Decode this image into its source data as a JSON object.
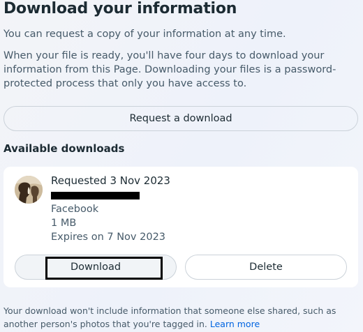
{
  "header": {
    "title": "Download your information"
  },
  "intro": {
    "paragraph1": "You can request a copy of your information at any time.",
    "paragraph2": "When your file is ready, you'll have four days to download your information from this Page. Downloading your files is a password-protected process that only you have access to."
  },
  "request_button_label": "Request a download",
  "downloads": {
    "section_title": "Available downloads",
    "items": [
      {
        "requested": "Requested 3 Nov 2023",
        "source": "Facebook",
        "size": "1 MB",
        "expiry": "Expires on 7 Nov 2023",
        "download_label": "Download",
        "delete_label": "Delete"
      }
    ]
  },
  "footer": {
    "text": "Your download won't include information that someone else shared, such as another person's photos that you're tagged in.",
    "link_text": "Learn more"
  },
  "colors": {
    "link": "#0064e0",
    "text_primary": "#1c2b33",
    "text_secondary": "#465a69"
  },
  "icons": {
    "avatar": "profile-photo"
  }
}
